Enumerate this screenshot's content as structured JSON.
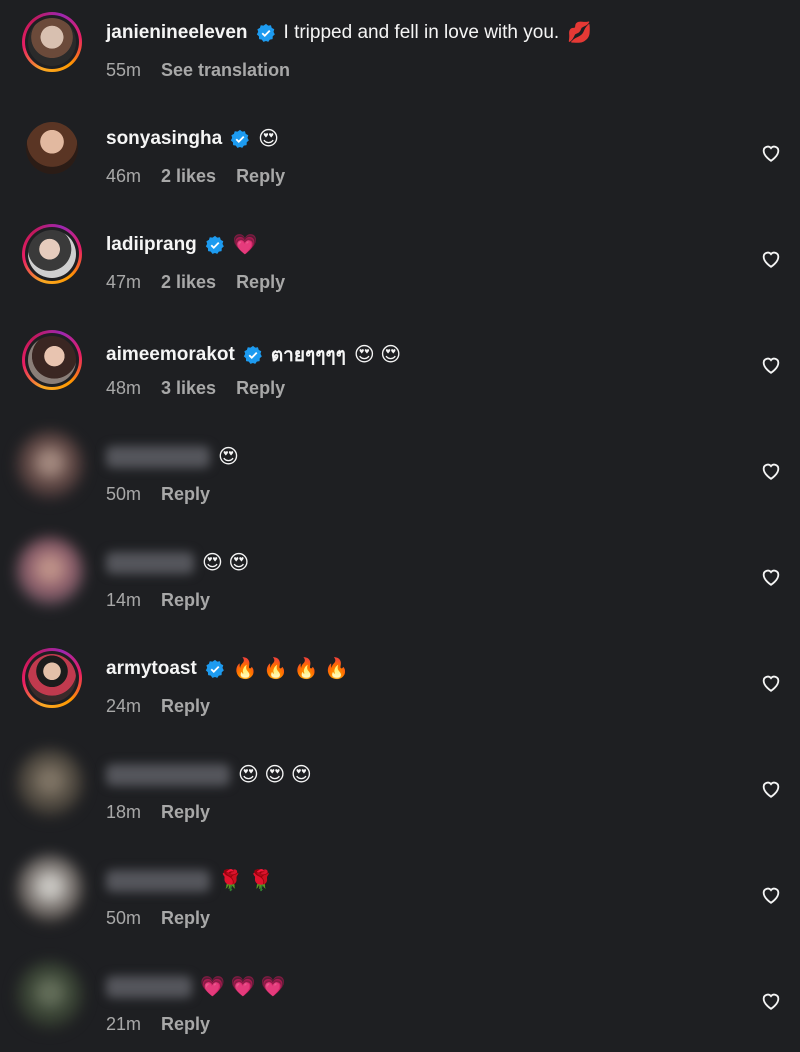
{
  "caption": {
    "username": "janienineeleven",
    "text": "I tripped and fell in love with you.",
    "emoji": "💋",
    "time": "55m",
    "translate_label": "See translation"
  },
  "comments": [
    {
      "username": "sonyasingha",
      "verified": true,
      "text": "",
      "emojis": "😍",
      "time": "46m",
      "likes": "2 likes",
      "reply": "Reply"
    },
    {
      "username": "ladiiprang",
      "verified": true,
      "text": "",
      "emojis": "💗",
      "time": "47m",
      "likes": "2 likes",
      "reply": "Reply"
    },
    {
      "username": "aimeemorakot",
      "verified": true,
      "text": "ตายๆๆๆๆ",
      "emojis": "😍 😍",
      "time": "48m",
      "likes": "3 likes",
      "reply": "Reply"
    },
    {
      "username": "",
      "verified": false,
      "text": "",
      "emojis": "😍",
      "time": "50m",
      "likes": "",
      "reply": "Reply"
    },
    {
      "username": "",
      "verified": false,
      "text": "",
      "emojis": "😍 😍",
      "time": "14m",
      "likes": "",
      "reply": "Reply"
    },
    {
      "username": "armytoast",
      "verified": true,
      "text": "",
      "emojis": "🔥 🔥 🔥 🔥",
      "time": "24m",
      "likes": "",
      "reply": "Reply"
    },
    {
      "username": "",
      "verified": false,
      "text": "",
      "emojis": "😍 😍 😍",
      "time": "18m",
      "likes": "",
      "reply": "Reply"
    },
    {
      "username": "",
      "verified": false,
      "text": "",
      "emojis": "🌹 🌹",
      "time": "50m",
      "likes": "",
      "reply": "Reply"
    },
    {
      "username": "",
      "verified": false,
      "text": "",
      "emojis": "💗 💗 💗",
      "time": "21m",
      "likes": "",
      "reply": "Reply"
    }
  ],
  "icons": {
    "verified": "verified-badge-icon",
    "like": "heart-outline-icon"
  },
  "colors": {
    "background": "#1e1f22",
    "verified": "#1d9bf0",
    "meta_text": "#a8a8a8"
  }
}
